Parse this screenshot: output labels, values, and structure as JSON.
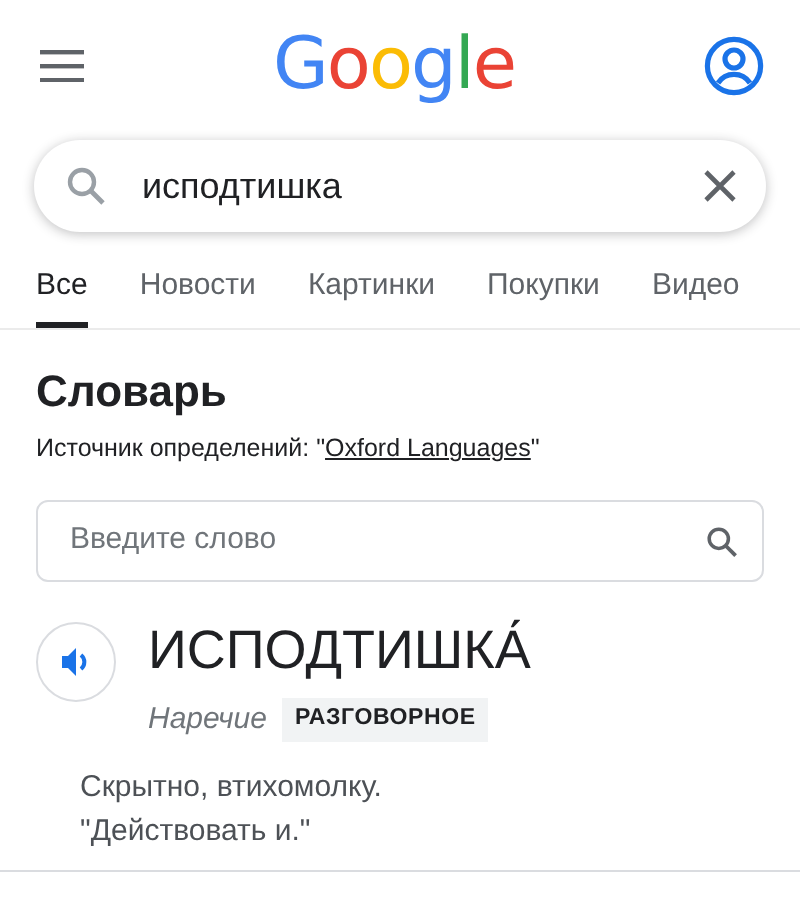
{
  "header": {
    "logo": "Google"
  },
  "search": {
    "value": "исподтишка"
  },
  "tabs": [
    {
      "label": "Все",
      "selected": true
    },
    {
      "label": "Новости",
      "selected": false
    },
    {
      "label": "Картинки",
      "selected": false
    },
    {
      "label": "Покупки",
      "selected": false
    },
    {
      "label": "Видео",
      "selected": false
    }
  ],
  "dictionary": {
    "title": "Словарь",
    "source_prefix": "Источник определений: \"",
    "source_link": "Oxford Languages",
    "source_suffix": "\"",
    "word_field": {
      "placeholder": "Введите слово"
    },
    "word": "ИСПОДТИШКА́",
    "part_of_speech": "Наречие",
    "register": "РАЗГОВОРНОЕ",
    "definition": "Скрытно, втихомолку.",
    "example": "\"Действовать и.\""
  }
}
